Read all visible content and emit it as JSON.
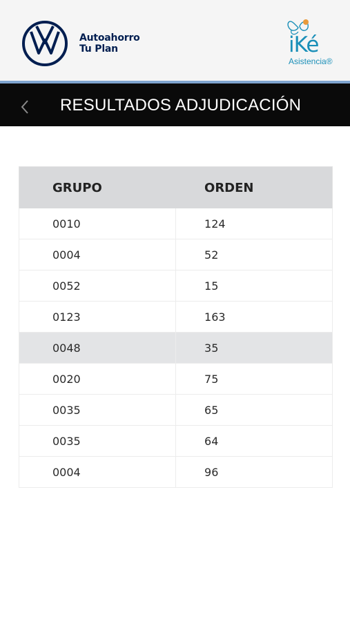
{
  "header": {
    "brand_line1": "Autoahorro",
    "brand_line2": "Tu Plan",
    "partner_word": "iKé",
    "partner_sub": "Asistencia®",
    "brand_color": "#001e50",
    "partner_color": "#1a8fb8"
  },
  "titlebar": {
    "title": "RESULTADOS ADJUDICACIÓN",
    "back_icon": "chevron-left-icon"
  },
  "table": {
    "headers": [
      "GRUPO",
      "ORDEN"
    ],
    "rows": [
      {
        "grupo": "0010",
        "orden": "124"
      },
      {
        "grupo": "0004",
        "orden": "52"
      },
      {
        "grupo": "0052",
        "orden": "15"
      },
      {
        "grupo": "0123",
        "orden": "163"
      },
      {
        "grupo": "0048",
        "orden": "35"
      },
      {
        "grupo": "0020",
        "orden": "75"
      },
      {
        "grupo": "0035",
        "orden": "65"
      },
      {
        "grupo": "0035",
        "orden": "64"
      },
      {
        "grupo": "0004",
        "orden": "96"
      }
    ],
    "highlighted_row_color": "#e3e4e6"
  }
}
